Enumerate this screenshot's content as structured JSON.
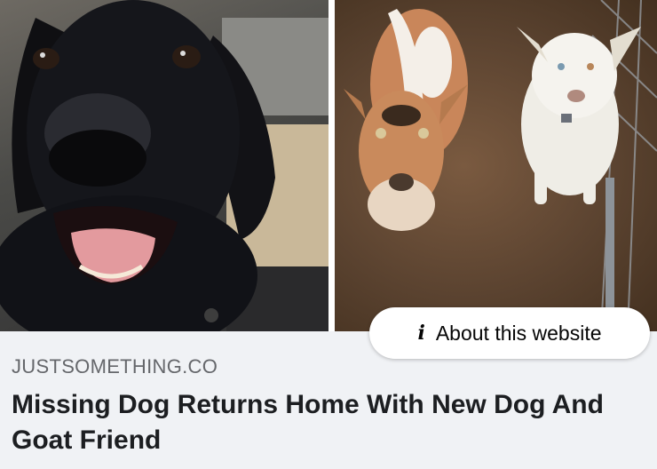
{
  "images": {
    "left_alt": "black-labrador-photo",
    "right_alt": "goat-and-white-dog-photo"
  },
  "about_button": {
    "icon": "info-icon",
    "icon_glyph": "i",
    "label": "About this website"
  },
  "link_preview": {
    "domain": "JUSTSOMETHING.CO",
    "headline": "Missing Dog Returns Home With New Dog And Goat Friend"
  },
  "colors": {
    "background": "#f0f2f5",
    "domain_text": "#65676b",
    "headline_text": "#1c1e21"
  }
}
